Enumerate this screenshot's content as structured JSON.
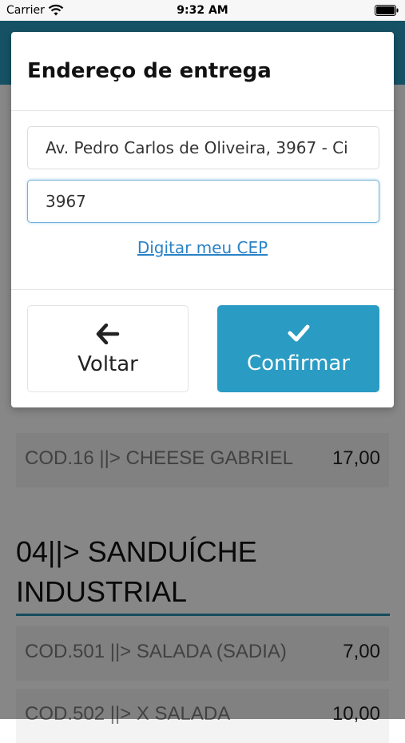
{
  "status_bar": {
    "carrier": "Carrier",
    "time": "9:32 AM"
  },
  "menu": {
    "rows_top": [
      {
        "name": "COD.16 ||> CHEESE GABRIEL",
        "price": "17,00"
      }
    ],
    "section": {
      "title": "04||> SANDUÍCHE INDUSTRIAL"
    },
    "rows_bottom": [
      {
        "name": "COD.501 ||> SALADA (SADIA)",
        "price": "7,00"
      },
      {
        "name": "COD.502 ||> X SALADA",
        "price": "10,00"
      }
    ]
  },
  "modal": {
    "title": "Endereço de entrega",
    "address_value": "Av. Pedro Carlos de Oliveira, 3967 - Ci",
    "number_value": "3967",
    "cep_link": "Digitar meu CEP",
    "back_label": "Voltar",
    "confirm_label": "Confirmar"
  },
  "colors": {
    "header": "#2b9bbf",
    "confirm": "#2a9bc3",
    "link": "#2a82c6",
    "accent_line": "#2b8fb0"
  },
  "icons": [
    "wifi-icon",
    "battery-icon",
    "arrow-left-icon",
    "check-icon"
  ]
}
